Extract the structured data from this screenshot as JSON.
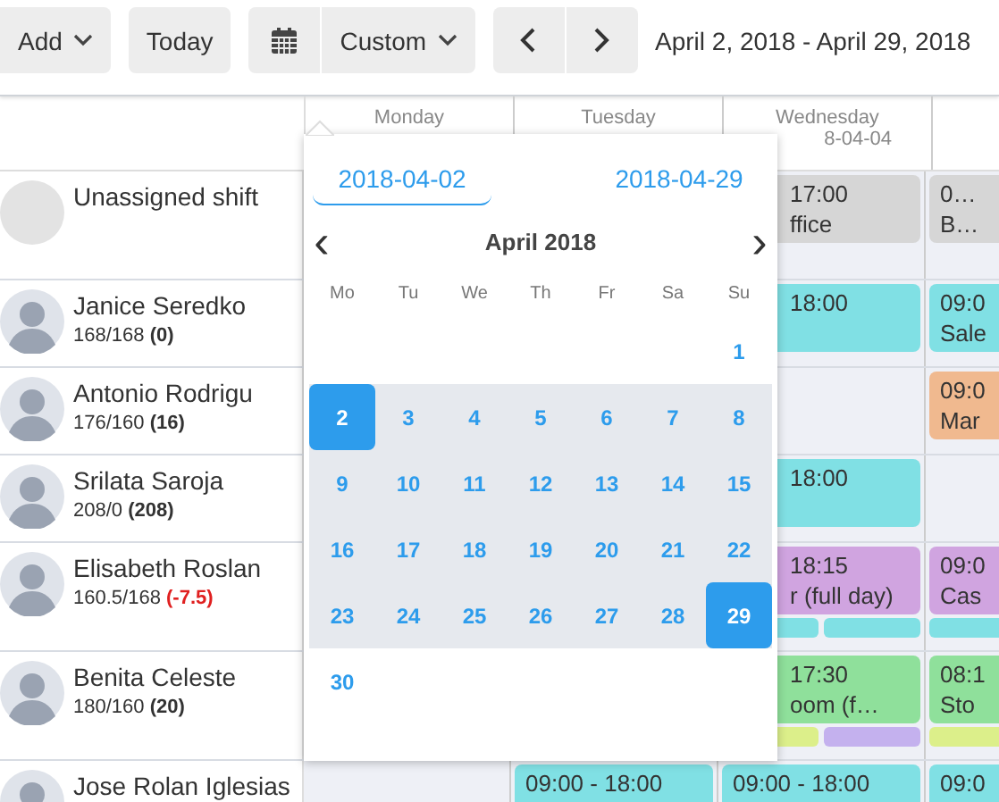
{
  "toolbar": {
    "buttons": [
      {
        "kind": "dropdown",
        "label": "Add"
      },
      {
        "kind": "plain",
        "label": "Today"
      }
    ],
    "view": {
      "label": "Custom"
    },
    "date_range": "April 2, 2018 - April 29, 2018"
  },
  "columns": [
    {
      "day": "Monday"
    },
    {
      "day": "Tuesday"
    },
    {
      "day": "Wednesday",
      "date": "8-04-04"
    }
  ],
  "rows": [
    {
      "kind": "unassigned",
      "name": "Unassigned shift",
      "wednesday": {
        "time": "17:00",
        "label": "ffice",
        "color": "#d6d6d6"
      },
      "thursday": {
        "time": "0…",
        "label": "B…",
        "color": "#d6d6d6"
      }
    },
    {
      "kind": "person",
      "name": "Janice Seredko",
      "hours": "168/168",
      "balance": "(0)",
      "negative": false,
      "wednesday": {
        "time": "18:00",
        "color": "#80e0e4"
      },
      "thursday": {
        "time": "09:0",
        "label": "Sale",
        "color": "#80e0e4"
      }
    },
    {
      "kind": "person",
      "name": "Antonio Rodrigu",
      "hours": "176/160",
      "balance": "(16)",
      "negative": false,
      "thursday": {
        "time": "09:0",
        "label": "Mar",
        "color": "#f0b98f"
      }
    },
    {
      "kind": "person",
      "name": "Srilata Saroja",
      "hours": "208/0",
      "balance": "(208)",
      "negative": false,
      "wednesday": {
        "time": "18:00",
        "color": "#80e0e4"
      }
    },
    {
      "kind": "person",
      "name": "Elisabeth Roslan",
      "hours": "160.5/168",
      "balance": "(-7.5)",
      "negative": true,
      "wednesday": {
        "time": "18:15",
        "label": "r (full day)",
        "color": "#d0a4e0",
        "bars": [
          {
            "color": "#80e0e4"
          },
          {
            "color": "#80e0e4"
          }
        ]
      },
      "thursday": {
        "time": "09:0",
        "label": "Cas",
        "color": "#d0a4e0",
        "bars": [
          {
            "color": "#80e0e4"
          }
        ]
      }
    },
    {
      "kind": "person",
      "name": "Benita Celeste",
      "hours": "180/160",
      "balance": "(20)",
      "negative": false,
      "wednesday": {
        "time": "17:30",
        "label": "oom (f…",
        "color": "#8fe09b",
        "bars": [
          {
            "color": "#dcef8a"
          },
          {
            "color": "#c4b1ee"
          }
        ]
      },
      "thursday": {
        "time": "08:1",
        "label": "Sto",
        "color": "#8fe09b",
        "bars": [
          {
            "color": "#dcef8a"
          }
        ]
      }
    },
    {
      "kind": "person",
      "name": "Jose Rolan Iglesias",
      "tuesday": {
        "time": "09:00 - 18:00",
        "color": "#80e0e4"
      },
      "wednesday": {
        "time": "09:00 - 18:00",
        "color": "#80e0e4"
      },
      "thursday": {
        "time": "09:0",
        "color": "#80e0e4"
      }
    }
  ],
  "picker": {
    "tabs": [
      {
        "label": "2018-04-02",
        "selected": true
      },
      {
        "label": "2018-04-29",
        "selected": false
      }
    ],
    "month": "April 2018",
    "prev": "‹",
    "next": "›",
    "weekdays": [
      "Mo",
      "Tu",
      "We",
      "Th",
      "Fr",
      "Sa",
      "Su"
    ],
    "weeks": [
      {
        "right_aligned": true,
        "days": [
          {
            "label": "1",
            "in_range": false,
            "selected": false
          }
        ]
      },
      {
        "right_aligned": false,
        "days": [
          {
            "label": "2",
            "in_range": true,
            "selected": true
          },
          {
            "label": "3",
            "in_range": true,
            "selected": false
          },
          {
            "label": "4",
            "in_range": true,
            "selected": false
          },
          {
            "label": "5",
            "in_range": true,
            "selected": false
          },
          {
            "label": "6",
            "in_range": true,
            "selected": false
          },
          {
            "label": "7",
            "in_range": true,
            "selected": false
          },
          {
            "label": "8",
            "in_range": true,
            "selected": false
          }
        ]
      },
      {
        "right_aligned": false,
        "days": [
          {
            "label": "9",
            "in_range": true,
            "selected": false
          },
          {
            "label": "10",
            "in_range": true,
            "selected": false
          },
          {
            "label": "11",
            "in_range": true,
            "selected": false
          },
          {
            "label": "12",
            "in_range": true,
            "selected": false
          },
          {
            "label": "13",
            "in_range": true,
            "selected": false
          },
          {
            "label": "14",
            "in_range": true,
            "selected": false
          },
          {
            "label": "15",
            "in_range": true,
            "selected": false
          }
        ]
      },
      {
        "right_aligned": false,
        "days": [
          {
            "label": "16",
            "in_range": true,
            "selected": false
          },
          {
            "label": "17",
            "in_range": true,
            "selected": false
          },
          {
            "label": "18",
            "in_range": true,
            "selected": false
          },
          {
            "label": "19",
            "in_range": true,
            "selected": false
          },
          {
            "label": "20",
            "in_range": true,
            "selected": false
          },
          {
            "label": "21",
            "in_range": true,
            "selected": false
          },
          {
            "label": "22",
            "in_range": true,
            "selected": false
          }
        ]
      },
      {
        "right_aligned": false,
        "days": [
          {
            "label": "23",
            "in_range": true,
            "selected": false
          },
          {
            "label": "24",
            "in_range": true,
            "selected": false
          },
          {
            "label": "25",
            "in_range": true,
            "selected": false
          },
          {
            "label": "26",
            "in_range": true,
            "selected": false
          },
          {
            "label": "27",
            "in_range": true,
            "selected": false
          },
          {
            "label": "28",
            "in_range": true,
            "selected": false
          },
          {
            "label": "29",
            "in_range": true,
            "selected": true
          }
        ]
      },
      {
        "right_aligned": false,
        "days": [
          {
            "label": "30",
            "in_range": false,
            "selected": false
          }
        ]
      }
    ]
  }
}
